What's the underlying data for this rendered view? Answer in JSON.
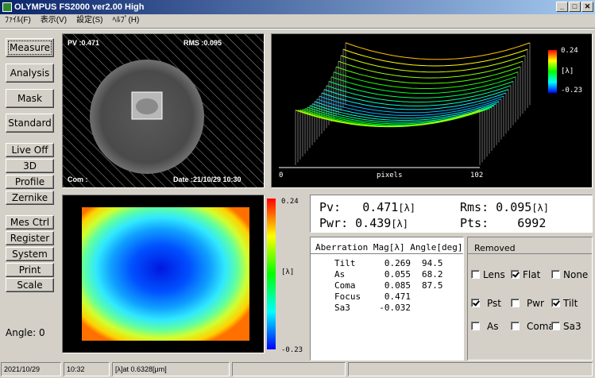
{
  "window": {
    "title": "OLYMPUS  FS2000 ver2.00  High",
    "minimize": "_",
    "maximize": "□",
    "close": "✕"
  },
  "menu": [
    "ﾌｧｲﾙ(F)",
    "表示(V)",
    "設定(S)",
    "ﾍﾙﾌﾟ(H)"
  ],
  "left_buttons": {
    "measure": "Measure",
    "analysis": "Analysis",
    "mask": "Mask",
    "standard": "Standard",
    "live_off": "Live Off",
    "three_d": "3D",
    "profile": "Profile",
    "zernike": "Zernike",
    "mes_ctrl": "Mes Ctrl",
    "register": "Register",
    "system": "System",
    "print": "Print",
    "scale": "Scale"
  },
  "angle_label": "Angle: 0",
  "interferogram": {
    "pv": "PV :0.471",
    "rms": "RMS :0.095",
    "com": "Com :",
    "date": "Date :21/10/29 10:30"
  },
  "plot3d": {
    "scale_max": "0.24",
    "scale_unit": "[λ]",
    "scale_min": "-0.23",
    "axis_start": "0",
    "axis_label": "pixels",
    "axis_end": "102"
  },
  "map2d": {
    "scale_max": "0.24",
    "scale_unit": "[λ]",
    "scale_min": "-0.23"
  },
  "readout": {
    "pv_label": "Pv:",
    "pv_value": "0.471",
    "pv_unit": "[λ]",
    "rms_label": "Rms:",
    "rms_value": "0.095",
    "rms_unit": "[λ]",
    "pwr_label": "Pwr:",
    "pwr_value": "0.439",
    "pwr_unit": "[λ]",
    "pts_label": "Pts:",
    "pts_value": "6992"
  },
  "aberration": {
    "header_name": "Aberration",
    "header_mag": "Mag[λ]",
    "header_angle": "Angle[deg]",
    "rows": [
      {
        "name": "Tilt",
        "mag": "0.269",
        "angle": "94.5"
      },
      {
        "name": "As",
        "mag": "0.055",
        "angle": "68.2"
      },
      {
        "name": "Coma",
        "mag": "0.085",
        "angle": "87.5"
      },
      {
        "name": "Focus",
        "mag": "0.471",
        "angle": ""
      },
      {
        "name": "Sa3",
        "mag": "-0.032",
        "angle": ""
      }
    ]
  },
  "removed": {
    "title": "Removed",
    "items": [
      {
        "label": "Lens",
        "checked": false
      },
      {
        "label": "Flat",
        "checked": true
      },
      {
        "label": "None",
        "checked": false
      },
      {
        "label": "Pst",
        "checked": true
      },
      {
        "label": "Pwr",
        "checked": false
      },
      {
        "label": "Tilt",
        "checked": true
      },
      {
        "label": "As",
        "checked": false
      },
      {
        "label": "Coma",
        "checked": false
      },
      {
        "label": "Sa3",
        "checked": false
      }
    ]
  },
  "statusbar": {
    "date": "2021/10/29",
    "time": "10:32",
    "wavelength": "[λ]at 0.6328[μm]"
  }
}
